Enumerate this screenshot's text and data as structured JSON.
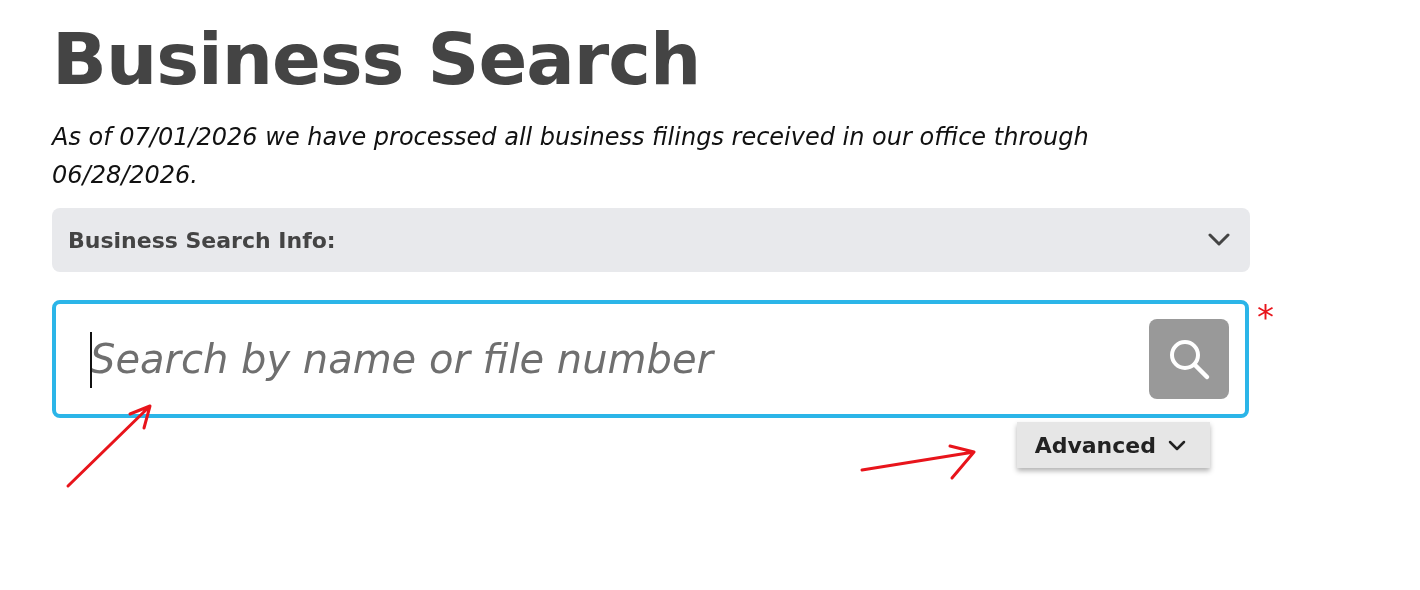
{
  "title": "Business Search",
  "notice": "As of 07/01/2026 we have processed all business filings received in our office through 06/28/2026.",
  "info_panel": {
    "label": "Business Search Info:",
    "expanded": false
  },
  "search": {
    "placeholder": "Search by name or file number",
    "focused": true,
    "required_mark": "*"
  },
  "advanced_button": {
    "label": "Advanced",
    "expanded": false
  }
}
